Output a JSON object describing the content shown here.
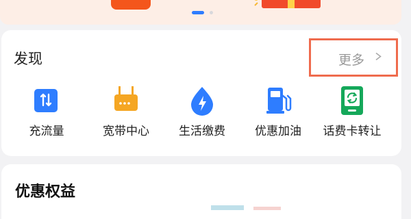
{
  "discover": {
    "title": "发现",
    "more_label": "更多",
    "items": [
      {
        "label": "充流量",
        "icon": "data-topup-icon"
      },
      {
        "label": "宽带中心",
        "icon": "broadband-router-icon"
      },
      {
        "label": "生活缴费",
        "icon": "utility-bill-icon"
      },
      {
        "label": "优惠加油",
        "icon": "fuel-pump-icon"
      },
      {
        "label": "话费卡转让",
        "icon": "phone-card-transfer-icon"
      }
    ]
  },
  "benefits": {
    "title": "优惠权益"
  },
  "colors": {
    "accent_blue": "#2e7dff",
    "accent_orange": "#f5a623",
    "accent_green": "#15a85a",
    "highlight_border": "#ef6b4d",
    "banner_button": "#f4561c"
  }
}
